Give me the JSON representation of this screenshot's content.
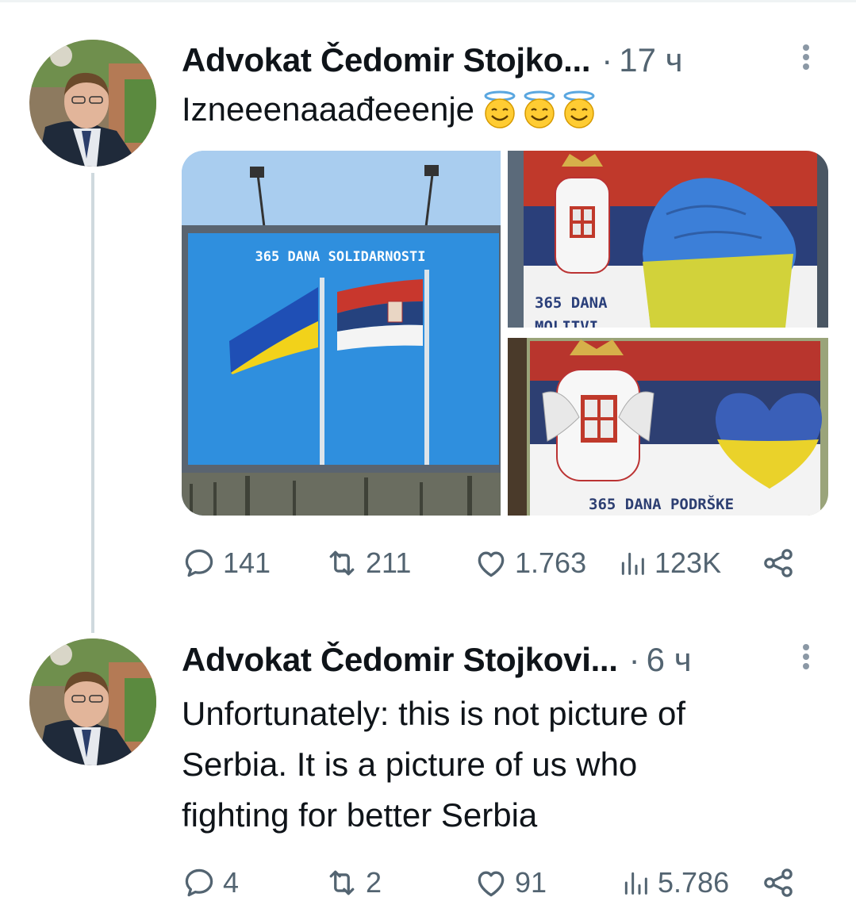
{
  "tweets": [
    {
      "author": "Advokat Čedomir Stojko...",
      "separator": "·",
      "time": "17 ч",
      "text": "Izneeenaaađeeenje",
      "emoji": [
        "smiling-face-with-halo",
        "smiling-face-with-halo",
        "smiling-face-with-halo"
      ],
      "media": {
        "left_caption": "365 DANA SOLIDARNOSTI",
        "top_right_caption": "365 DANA",
        "top_right_caption_cut": "MOLITVI",
        "bottom_right_caption": "365 DANA PODRŠKE"
      },
      "stats": {
        "replies": "141",
        "retweets": "211",
        "likes": "1.763",
        "views": "123K"
      }
    },
    {
      "author": "Advokat Čedomir Stojkovi...",
      "separator": "·",
      "time": "6 ч",
      "text_lines": [
        "Unfortunately: this is not picture of",
        "Serbia. It is a picture of us who",
        "fighting for better Serbia"
      ],
      "stats": {
        "replies": "4",
        "retweets": "2",
        "likes": "91",
        "views": "5.786"
      }
    }
  ],
  "colors": {
    "text": "#0f1419",
    "muted": "#536471",
    "thread_line": "#cfd9de"
  },
  "icons": [
    "reply-icon",
    "retweet-icon",
    "like-icon",
    "views-icon",
    "share-icon",
    "more-icon"
  ]
}
